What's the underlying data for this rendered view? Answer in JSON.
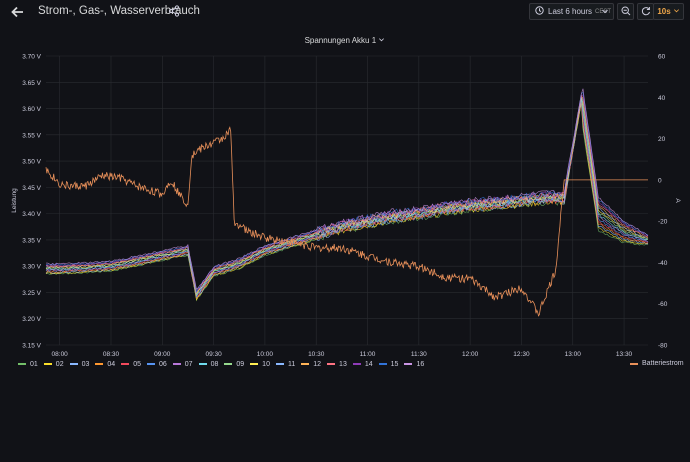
{
  "header": {
    "title": "Strom-, Gas-, Wasserverbrauch",
    "time_range": "Last 6 hours",
    "timezone": "CEST",
    "refresh_interval": "10s"
  },
  "panel": {
    "title": "Spannungen Akku 1"
  },
  "colors": {
    "background": "#111217",
    "grid": "#2a2c31",
    "text": "#ccccdc",
    "accent": "#f0a74a",
    "batteriestrom": "#e8905a"
  },
  "icons": [
    "arrow-left-icon",
    "share-icon",
    "clock-icon",
    "chevron-down-icon",
    "zoom-out-icon",
    "refresh-icon"
  ],
  "chart_data": {
    "type": "line",
    "title": "Spannungen Akku 1",
    "ylabel": "Leistung",
    "y2label": "A",
    "x_ticks": [
      "08:00",
      "08:30",
      "09:00",
      "09:30",
      "10:00",
      "10:30",
      "11:00",
      "11:30",
      "12:00",
      "12:30",
      "13:00",
      "13:30"
    ],
    "x_range": [
      "07:52",
      "13:44"
    ],
    "y_ticks": [
      "3.70 V",
      "3.65 V",
      "3.60 V",
      "3.55 V",
      "3.50 V",
      "3.45 V",
      "3.40 V",
      "3.35 V",
      "3.30 V",
      "3.25 V",
      "3.20 V",
      "3.15 V"
    ],
    "ylim": [
      3.15,
      3.7
    ],
    "y2_ticks": [
      "60",
      "40",
      "20",
      "0",
      "-20",
      "-40",
      "-60",
      "-80"
    ],
    "y2lim": [
      -80,
      60
    ],
    "grid": true,
    "legend_placement": "bottom",
    "series": [
      {
        "name": "01",
        "color": "#73bf69"
      },
      {
        "name": "02",
        "color": "#fade2a"
      },
      {
        "name": "03",
        "color": "#8ab8ff"
      },
      {
        "name": "04",
        "color": "#ff9830"
      },
      {
        "name": "05",
        "color": "#f2495c"
      },
      {
        "name": "06",
        "color": "#5794f2"
      },
      {
        "name": "07",
        "color": "#b877d9"
      },
      {
        "name": "08",
        "color": "#70dbed"
      },
      {
        "name": "09",
        "color": "#96d98d"
      },
      {
        "name": "10",
        "color": "#ffee52"
      },
      {
        "name": "11",
        "color": "#8ab8ff"
      },
      {
        "name": "12",
        "color": "#ffb357"
      },
      {
        "name": "13",
        "color": "#ff7383"
      },
      {
        "name": "14",
        "color": "#8f3bb8"
      },
      {
        "name": "15",
        "color": "#3274d9"
      },
      {
        "name": "16",
        "color": "#ca95e5"
      }
    ],
    "voltage_profile": [
      [
        "07:52",
        3.295
      ],
      [
        "08:00",
        3.295
      ],
      [
        "08:15",
        3.297
      ],
      [
        "08:30",
        3.3
      ],
      [
        "08:45",
        3.31
      ],
      [
        "09:00",
        3.32
      ],
      [
        "09:15",
        3.33
      ],
      [
        "09:20",
        3.245
      ],
      [
        "09:30",
        3.29
      ],
      [
        "09:45",
        3.305
      ],
      [
        "10:00",
        3.33
      ],
      [
        "10:15",
        3.345
      ],
      [
        "10:30",
        3.36
      ],
      [
        "10:45",
        3.375
      ],
      [
        "11:00",
        3.385
      ],
      [
        "11:15",
        3.395
      ],
      [
        "11:30",
        3.4
      ],
      [
        "11:45",
        3.41
      ],
      [
        "12:00",
        3.415
      ],
      [
        "12:15",
        3.42
      ],
      [
        "12:30",
        3.425
      ],
      [
        "12:45",
        3.43
      ],
      [
        "12:55",
        3.43
      ],
      [
        "13:05",
        3.62
      ],
      [
        "13:15",
        3.4
      ],
      [
        "13:30",
        3.365
      ],
      [
        "13:44",
        3.35
      ]
    ],
    "batteriestrom": {
      "name": "Batteriestrom",
      "color": "#e8905a",
      "axis": "right",
      "points": [
        [
          "07:52",
          5
        ],
        [
          "08:00",
          -2
        ],
        [
          "08:05",
          -3
        ],
        [
          "08:15",
          -3
        ],
        [
          "08:25",
          2
        ],
        [
          "08:35",
          1
        ],
        [
          "08:45",
          -3
        ],
        [
          "09:00",
          -7
        ],
        [
          "09:05",
          0
        ],
        [
          "09:10",
          -7
        ],
        [
          "09:15",
          -12
        ],
        [
          "09:17",
          11
        ],
        [
          "09:20",
          14
        ],
        [
          "09:30",
          18
        ],
        [
          "09:35",
          20
        ],
        [
          "09:40",
          24
        ],
        [
          "09:42",
          -20
        ],
        [
          "09:50",
          -25
        ],
        [
          "10:00",
          -28
        ],
        [
          "10:15",
          -30
        ],
        [
          "10:30",
          -33
        ],
        [
          "10:45",
          -33
        ],
        [
          "11:00",
          -37
        ],
        [
          "11:15",
          -40
        ],
        [
          "11:30",
          -42
        ],
        [
          "11:45",
          -47
        ],
        [
          "12:00",
          -48
        ],
        [
          "12:15",
          -57
        ],
        [
          "12:30",
          -52
        ],
        [
          "12:40",
          -65
        ],
        [
          "12:50",
          -44
        ],
        [
          "12:55",
          0
        ],
        [
          "13:00",
          0
        ],
        [
          "13:10",
          0
        ],
        [
          "13:44",
          0
        ]
      ]
    }
  },
  "legend": {
    "items": [
      "01",
      "02",
      "03",
      "04",
      "05",
      "06",
      "07",
      "08",
      "09",
      "10",
      "11",
      "12",
      "13",
      "14",
      "15",
      "16"
    ],
    "right_item": "Batteriestrom"
  }
}
